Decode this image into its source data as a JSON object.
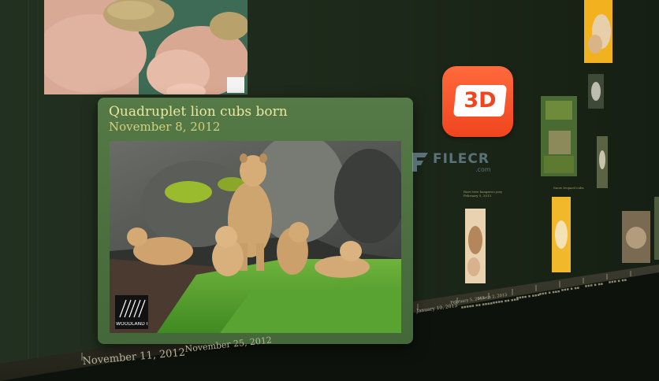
{
  "featured_card": {
    "title": "Quadruplet lion cubs born",
    "date": "November 8, 2012",
    "photo_logo_text": "WOODLAND PARK ZOO"
  },
  "badge": {
    "label": "3D"
  },
  "watermark": {
    "text": "FILECR",
    "sub": ".com"
  },
  "timeline": {
    "labels": [
      "November 11, 2012",
      "November 25, 2012",
      "January 10, 2013",
      "February 5, 2013",
      "March 2, 2013"
    ]
  },
  "wall_captions": [
    {
      "title": "Rare tree kangaroo joey",
      "subtitle": "February 5, 2013"
    },
    {
      "title": "Snow leopard cubs",
      "subtitle": ""
    }
  ],
  "colors": {
    "wall": "#1f2b1b",
    "card": "#4f733f",
    "card_title": "#e9e6a0",
    "card_date": "#cfd07f",
    "badge": "#f0451f",
    "timeline_label": "#b7b29a"
  }
}
